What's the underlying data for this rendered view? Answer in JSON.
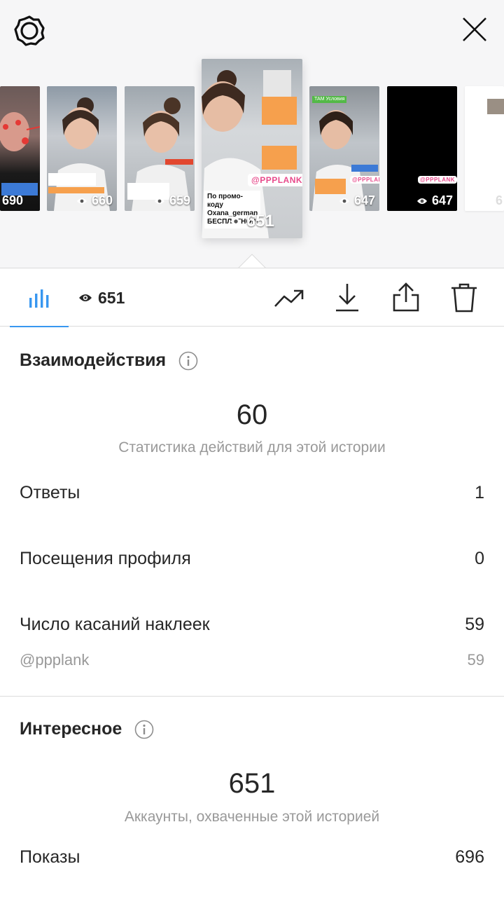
{
  "header": {
    "settings_icon": "gear-icon",
    "close_icon": "close-icon"
  },
  "stories": [
    {
      "views": "690",
      "background": "dark"
    },
    {
      "views": "660",
      "background": "light"
    },
    {
      "views": "659",
      "background": "light"
    },
    {
      "views": "651",
      "background": "light",
      "selected": true,
      "promo_text": "По промо-коду Oxana_german БЕСПЛАТНО!!!",
      "brand_sticker": "@PPPLANK"
    },
    {
      "views": "647",
      "background": "light",
      "tag": "ТАМ Условия",
      "brand_sticker": "@PPPLANK"
    },
    {
      "views": "647",
      "background": "black",
      "brand_sticker": "@PPPLANK"
    },
    {
      "views": "6",
      "background": "white"
    }
  ],
  "toolbar": {
    "insights_icon": "bar-chart-icon",
    "views_icon": "eye-icon",
    "views_count": "651",
    "actions": [
      "trending-icon",
      "download-icon",
      "share-icon",
      "trash-icon"
    ]
  },
  "interactions": {
    "title": "Взаимодействия",
    "total": "60",
    "subtitle": "Статистика действий для этой истории",
    "rows": [
      {
        "label": "Ответы",
        "value": "1"
      },
      {
        "label": "Посещения профиля",
        "value": "0"
      },
      {
        "label": "Число касаний наклеек",
        "value": "59"
      }
    ],
    "sticker_row": {
      "label": "@ppplank",
      "value": "59"
    }
  },
  "discovery": {
    "title": "Интересное",
    "total": "651",
    "subtitle": "Аккаунты, охваченные этой историей",
    "rows": [
      {
        "label": "Показы",
        "value": "696"
      }
    ]
  },
  "colors": {
    "accent": "#3897f0",
    "muted": "#999999",
    "text": "#262626",
    "divider": "#dbdbdb"
  }
}
